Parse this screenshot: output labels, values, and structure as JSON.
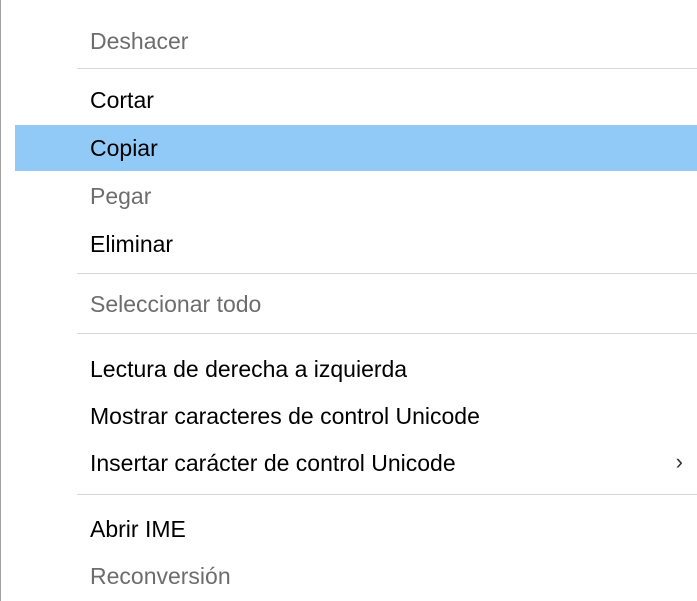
{
  "menu": {
    "items": [
      {
        "label": "Deshacer",
        "disabled": true
      },
      {
        "label": "Cortar",
        "disabled": false
      },
      {
        "label": "Copiar",
        "disabled": false,
        "highlighted": true
      },
      {
        "label": "Pegar",
        "disabled": true
      },
      {
        "label": "Eliminar",
        "disabled": false
      },
      {
        "label": "Seleccionar todo",
        "disabled": true
      },
      {
        "label": "Lectura de derecha a izquierda",
        "disabled": false
      },
      {
        "label": "Mostrar caracteres de control Unicode",
        "disabled": false
      },
      {
        "label": "Insertar carácter de control Unicode",
        "disabled": false,
        "submenu": true
      },
      {
        "label": "Abrir IME",
        "disabled": false
      },
      {
        "label": "Reconversión",
        "disabled": true
      }
    ],
    "submenu_glyph": "›"
  },
  "colors": {
    "highlight": "#91c9f7",
    "disabled_text": "#6d6d6d",
    "separator": "#d7d7d7",
    "border": "#a0a0a0"
  }
}
